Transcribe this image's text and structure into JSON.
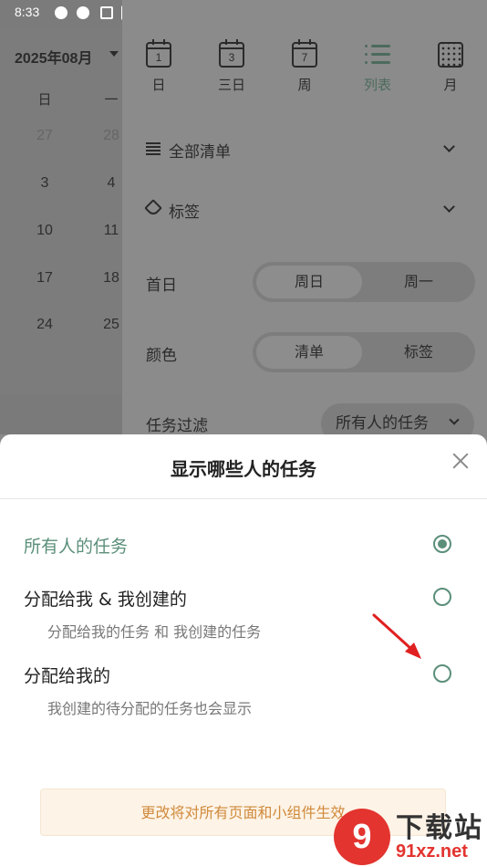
{
  "status_bar": {
    "time": "8:33"
  },
  "calendar": {
    "month": "2025年08月",
    "weekday_headers": [
      "日",
      "一"
    ],
    "rows": [
      [
        "27",
        "28"
      ],
      [
        "3",
        "4"
      ],
      [
        "10",
        "11"
      ],
      [
        "17",
        "18"
      ],
      [
        "24",
        "25"
      ]
    ]
  },
  "views": [
    {
      "label": "日",
      "icon_text": "1"
    },
    {
      "label": "三日",
      "icon_text": "3"
    },
    {
      "label": "周",
      "icon_text": "7"
    },
    {
      "label": "列表",
      "icon_text": ""
    },
    {
      "label": "月",
      "icon_text": ""
    }
  ],
  "active_view": "列表",
  "settings": {
    "all_lists": "全部清单",
    "tags": "标签",
    "first_day": {
      "label": "首日",
      "options": [
        "周日",
        "周一"
      ],
      "selected": "周日"
    },
    "color": {
      "label": "颜色",
      "options": [
        "清单",
        "标签"
      ],
      "selected": "清单"
    },
    "task_filter": {
      "label": "任务过滤",
      "value": "所有人的任务"
    }
  },
  "sheet": {
    "title": "显示哪些人的任务",
    "options": [
      {
        "label": "所有人的任务",
        "sub": "",
        "selected": true
      },
      {
        "label": "分配给我 & 我创建的",
        "sub": "分配给我的任务 和 我创建的任务",
        "selected": false
      },
      {
        "label": "分配给我的",
        "sub": "我创建的待分配的任务也会显示",
        "selected": false
      }
    ],
    "notice": "更改将对所有页面和小组件生效"
  },
  "watermark": {
    "logo": "9",
    "text": "下载站",
    "url": "91xz.net"
  },
  "colors": {
    "accent": "#5b8f7a",
    "notice_text": "#d08a3b",
    "notice_bg": "#fdf3e6",
    "arrow": "#e02020"
  }
}
